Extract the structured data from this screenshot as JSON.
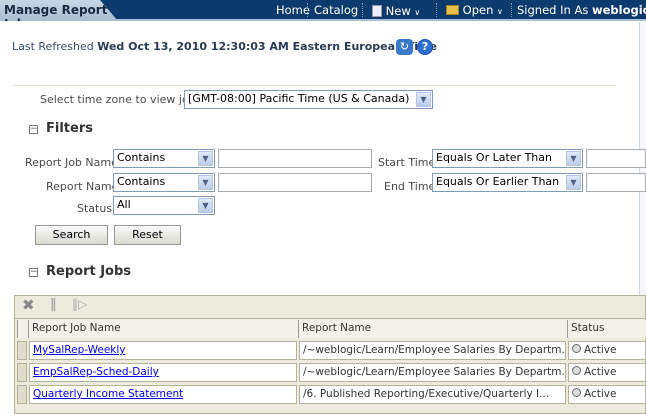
{
  "header": {
    "title": "Manage Report Jobs",
    "nav": {
      "home": "Home",
      "catalog": "Catalog",
      "new": "New",
      "open": "Open",
      "signed_in_as": "Signed In As",
      "user": "weblogic"
    }
  },
  "refresh": {
    "label": "Last Refreshed",
    "value": "Wed Oct 13, 2010 12:30:03 AM Eastern European Time"
  },
  "timezone": {
    "label": "Select time zone to view jobs",
    "value": "[GMT-08:00] Pacific Time (US & Canada)"
  },
  "filters": {
    "heading": "Filters",
    "report_job_name": {
      "label": "Report Job Name",
      "op": "Contains",
      "value": ""
    },
    "report_name": {
      "label": "Report Name",
      "op": "Contains",
      "value": ""
    },
    "status": {
      "label": "Status",
      "value": "All"
    },
    "start_time": {
      "label": "Start Time",
      "op": "Equals Or Later Than",
      "value": ""
    },
    "end_time": {
      "label": "End Time",
      "op": "Equals Or Earlier Than",
      "value": ""
    },
    "search": "Search",
    "reset": "Reset"
  },
  "jobs": {
    "heading": "Report Jobs",
    "columns": [
      "Report Job Name",
      "Report Name",
      "Status"
    ],
    "rows": [
      {
        "name": "MySalRep-Weekly",
        "report": "/~weblogic/Learn/Employee Salaries By Departm...",
        "status": "Active"
      },
      {
        "name": "EmpSalRep-Sched-Daily",
        "report": "/~weblogic/Learn/Employee Salaries By Departm...",
        "status": "Active"
      },
      {
        "name": "Quarterly Income Statement",
        "report": "/6. Published Reporting/Executive/Quarterly I...",
        "status": "Active"
      }
    ]
  }
}
